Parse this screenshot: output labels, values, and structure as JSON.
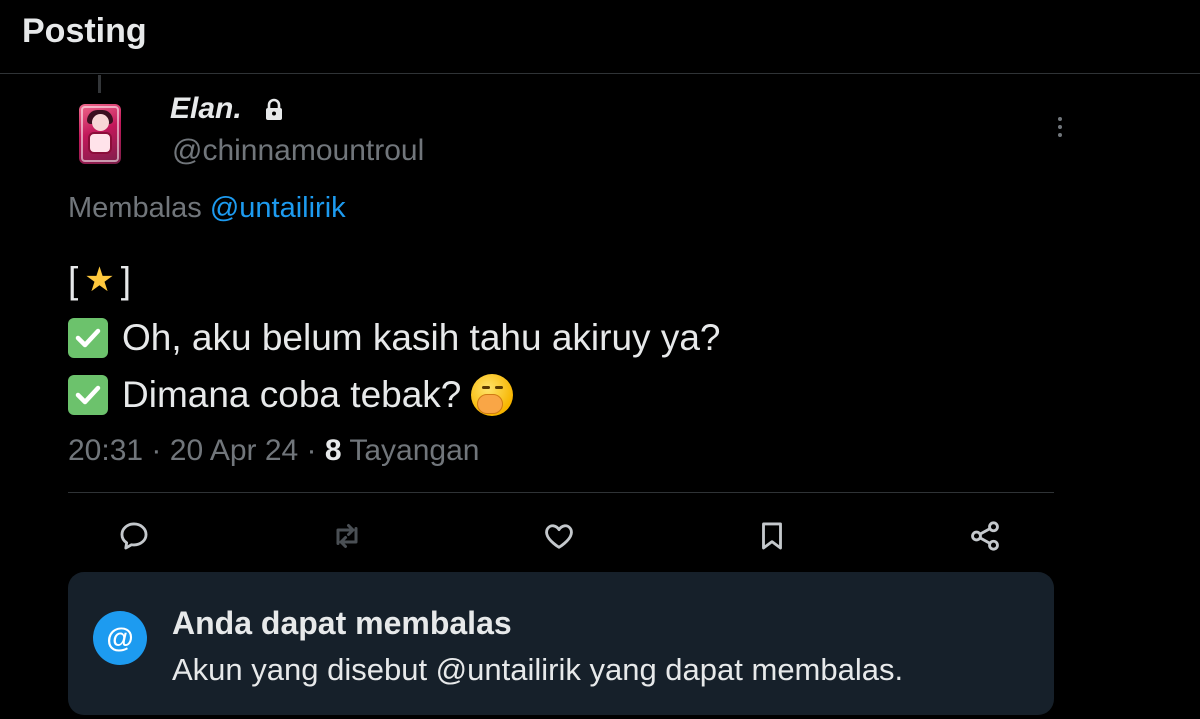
{
  "header": {
    "title": "Posting"
  },
  "tweet": {
    "display_name": "Elan.",
    "handle": "@chinnamountroul",
    "reply_prefix": "Membalas",
    "reply_to": "@untailirik",
    "line1_open": "[",
    "line1_close": "]",
    "line2": "Oh, aku belum kasih tahu akiruy ya?",
    "line3": "Dimana coba tebak?",
    "time": "20:31",
    "date": "20 Apr 24",
    "separator": "·",
    "views_count": "8",
    "views_label": "Tayangan"
  },
  "icons": {
    "lock": "lock-icon",
    "more": "more-vertical-icon",
    "reply": "reply-icon",
    "repost": "repost-icon",
    "like": "heart-icon",
    "bookmark": "bookmark-icon",
    "share": "share-icon",
    "star": "star-emoji",
    "check": "check-mark-emoji",
    "face": "face-with-hand-over-mouth-emoji"
  },
  "info_box": {
    "icon": "@",
    "title": "Anda dapat membalas",
    "text": "Akun yang disebut @untailirik yang dapat membalas."
  },
  "colors": {
    "background": "#000000",
    "text": "#e7e9ea",
    "muted": "#71767b",
    "accent": "#1d9bf0",
    "info_bg": "#16202a"
  }
}
